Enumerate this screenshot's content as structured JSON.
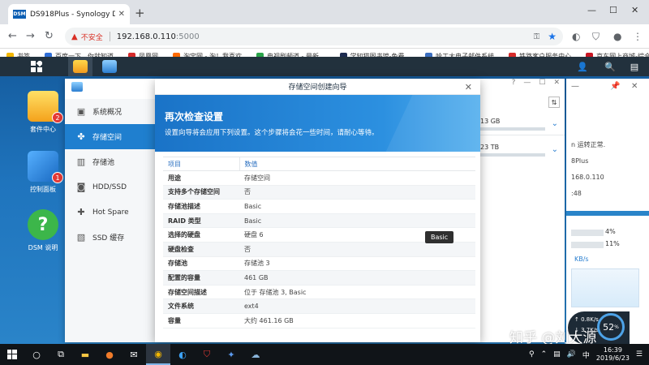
{
  "browser": {
    "tab_title": "DS918Plus - Synology DiskStat",
    "tab_favicon": "DSM",
    "new_tab": "+",
    "insecure_label": "不安全",
    "url_host": "192.168.0.110",
    "url_port": ":5000"
  },
  "bookmarks": [
    {
      "label": "书签",
      "color": "#f2b600"
    },
    {
      "label": "百度一下，你就知道",
      "color": "#2f6ed6"
    },
    {
      "label": "凤凰网",
      "color": "#d62b2b"
    },
    {
      "label": "淘宝网 - 淘！我喜欢",
      "color": "#ff6a00"
    },
    {
      "label": "电视剧频道 - 最新...",
      "color": "#2aa44a"
    },
    {
      "label": "学知猫图书馆-免费...",
      "color": "#1d2b50"
    },
    {
      "label": "哈工大电子邮件系统",
      "color": "#3b6ebf"
    },
    {
      "label": "铁路客户服务中心",
      "color": "#d62b2b"
    },
    {
      "label": "京东网上商城-综合...",
      "color": "#c81623"
    }
  ],
  "desktop_icons": [
    {
      "label": "套件中心",
      "badge": "2"
    },
    {
      "label": "控制面板",
      "badge": "1"
    },
    {
      "label": "DSM 说明",
      "badge": ""
    }
  ],
  "storage_manager": {
    "nav": [
      {
        "label": "系统概况",
        "icon": "overview-icon"
      },
      {
        "label": "存储空间",
        "icon": "volume-icon"
      },
      {
        "label": "存储池",
        "icon": "storage-pool-icon"
      },
      {
        "label": "HDD/SSD",
        "icon": "hdd-icon"
      },
      {
        "label": "Hot Spare",
        "icon": "hot-spare-icon"
      },
      {
        "label": "SSD 缓存",
        "icon": "ssd-cache-icon"
      }
    ],
    "right_rows": [
      "13 GB",
      "23 TB"
    ]
  },
  "side_widget": {
    "lines": [
      "n 运转正常.",
      "8Plus",
      "168.0.110",
      ":48"
    ],
    "cpu": "4%",
    "ram": "11%",
    "rate": "KB/s"
  },
  "wizard": {
    "title": "存储空间创建向导",
    "heading": "再次检查设置",
    "subtitle": "设置向导将会应用下列设置。这个步骤将会花一些时间，请耐心等待。",
    "col_item": "项目",
    "col_value": "数值",
    "rows": [
      {
        "k": "用途",
        "v": "存储空间"
      },
      {
        "k": "支持多个存储空间",
        "v": "否"
      },
      {
        "k": "存储池描述",
        "v": "Basic"
      },
      {
        "k": "RAID 类型",
        "v": "Basic"
      },
      {
        "k": "选择的硬盘",
        "v": "硬盘 6"
      },
      {
        "k": "硬盘检查",
        "v": "否"
      },
      {
        "k": "存储池",
        "v": "存储池 3"
      },
      {
        "k": "配置的容量",
        "v": "461 GB"
      },
      {
        "k": "存储空间描述",
        "v": "位于 存储池 3, Basic"
      },
      {
        "k": "文件系统",
        "v": "ext4"
      },
      {
        "k": "容量",
        "v": "大约 461.16 GB"
      }
    ],
    "tooltip": "Basic"
  },
  "resource_monitor": {
    "upload": "0.8K/s",
    "download": "3.7K/s",
    "percent": "52"
  },
  "watermark": "知乎 @刘大源",
  "taskbar": {
    "time": "16:39",
    "date": "2019/6/23",
    "ime": "中"
  }
}
